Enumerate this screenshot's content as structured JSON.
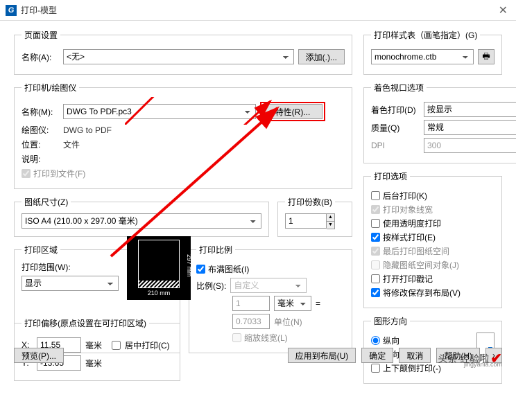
{
  "window": {
    "title": "打印-模型"
  },
  "page_setup": {
    "legend": "页面设置",
    "name_label": "名称(A):",
    "name_value": "<无>",
    "add_btn": "添加(.)..."
  },
  "printer": {
    "legend": "打印机/绘图仪",
    "name_label": "名称(M):",
    "name_value": "DWG To PDF.pc3",
    "props_btn": "特性(R)...",
    "plotter_label": "绘图仪:",
    "plotter_value": "DWG to PDF",
    "location_label": "位置:",
    "location_value": "文件",
    "desc_label": "说明:",
    "print_to_file": "打印到文件(F)",
    "preview_w": "210 mm"
  },
  "paper_size": {
    "legend": "图纸尺寸(Z)",
    "value": "ISO A4 (210.00 x 297.00 毫米)"
  },
  "copies": {
    "legend": "打印份数(B)",
    "value": "1"
  },
  "area": {
    "legend": "打印区域",
    "range_label": "打印范围(W):",
    "range_value": "显示"
  },
  "scale": {
    "legend": "打印比例",
    "fit": "布满图纸(I)",
    "ratio_label": "比例(S):",
    "ratio_value": "自定义",
    "num1": "1",
    "unit1": "毫米",
    "num2": "0.7033",
    "unit2": "单位(N)",
    "scale_lw": "缩放线宽(L)"
  },
  "offset": {
    "legend": "打印偏移(原点设置在可打印区域)",
    "x_label": "X:",
    "x_value": "11.55",
    "y_label": "Y:",
    "y_value": "-13.65",
    "unit": "毫米",
    "center": "居中打印(C)"
  },
  "style": {
    "legend": "打印样式表（画笔指定）(G)",
    "value": "monochrome.ctb"
  },
  "shade": {
    "legend": "着色视口选项",
    "shade_label": "着色打印(D)",
    "shade_value": "按显示",
    "quality_label": "质量(Q)",
    "quality_value": "常规",
    "dpi_label": "DPI",
    "dpi_value": "300"
  },
  "options": {
    "legend": "打印选项",
    "bg": "后台打印(K)",
    "lw": "打印对象线宽",
    "trans": "使用透明度打印",
    "style": "按样式打印(E)",
    "paperspace_last": "最后打印图纸空间",
    "hide_ps": "隐藏图纸空间对象(J)",
    "stamp": "打开打印戳记",
    "save_layout": "将修改保存到布局(V)"
  },
  "orientation": {
    "legend": "图形方向",
    "portrait": "纵向",
    "landscape": "横向",
    "upside": "上下颠倒打印(-)"
  },
  "footer": {
    "preview": "预览(P)...",
    "apply": "应用到布局(U)",
    "ok": "确定",
    "cancel": "取消",
    "help": "帮助(H)"
  },
  "watermark": {
    "main": "头条 经验啦",
    "sub": "jingyanla.com"
  }
}
